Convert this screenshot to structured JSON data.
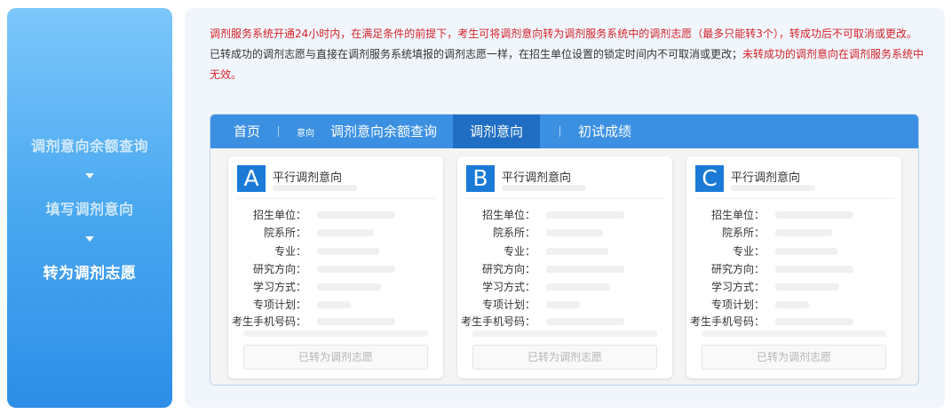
{
  "sidebar": {
    "steps": [
      {
        "label": "调剂意向余额查询"
      },
      {
        "label": "填写调剂意向"
      },
      {
        "label": "转为调剂志愿"
      }
    ]
  },
  "notice": {
    "line1": "调剂服务系统开通24小时内，在满足条件的前提下，考生可将调剂意向转为调剂服务系统中的调剂志愿（最多只能转3个），转成功后不可取消或更改。",
    "line2_normal": "已转成功的调剂志愿与直接在调剂服务系统填报的调剂志愿一样，在招生单位设置的锁定时间内不可取消或更改；",
    "line2_red": "未转成功的调剂意向在调剂服务系统中无效。"
  },
  "nav": {
    "home": "首页",
    "small": "意向",
    "balance_query": "调剂意向余额查询",
    "intent": "调剂意向",
    "scores": "初试成绩"
  },
  "cards": [
    {
      "letter": "A",
      "title": "平行调剂意向",
      "button": "已转为调剂志愿"
    },
    {
      "letter": "B",
      "title": "平行调剂意向",
      "button": "已转为调剂志愿"
    },
    {
      "letter": "C",
      "title": "平行调剂意向",
      "button": "已转为调剂志愿"
    }
  ],
  "fields": {
    "school": "招生单位：",
    "department": "院系所：",
    "major": "专业：",
    "direction": "研究方向：",
    "study_mode": "学习方式：",
    "special_plan": "专项计划：",
    "phone": "考生手机号码："
  },
  "colors": {
    "accent": "#3c90e2",
    "nav_active": "#1f6ec3",
    "letter_bg": "#1a7ad6",
    "warning": "#d4232b"
  }
}
